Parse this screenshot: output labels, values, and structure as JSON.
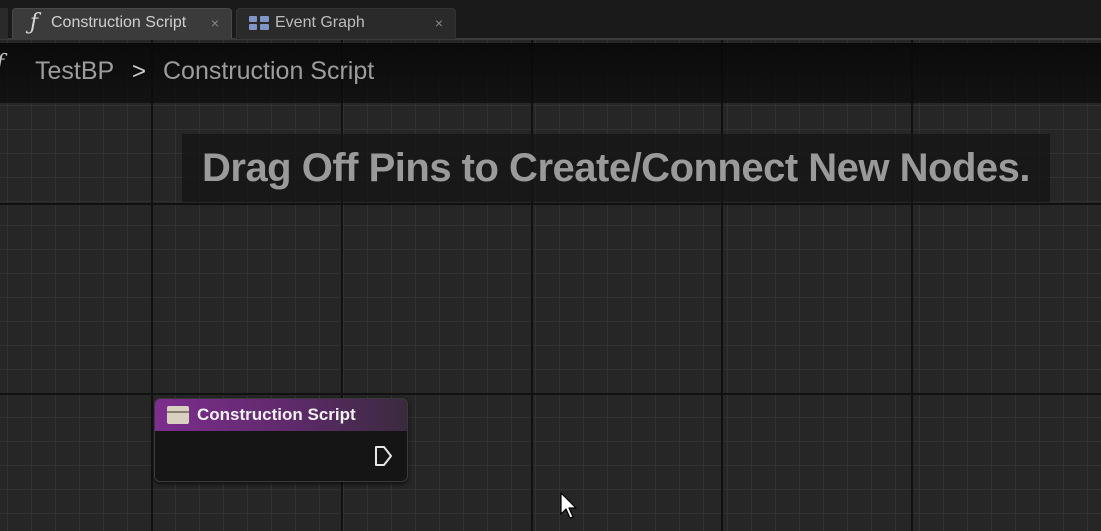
{
  "tabs": [
    {
      "label": "Construction Script",
      "icon": "function-icon",
      "active": true,
      "close": "×"
    },
    {
      "label": "Event Graph",
      "icon": "event-graph-icon",
      "active": false,
      "close": "×"
    }
  ],
  "breadcrumb": {
    "icon_glyph": "f",
    "root": "TestBP",
    "separator": ">",
    "current": "Construction Script"
  },
  "hint": "Drag Off Pins to Create/Connect New Nodes.",
  "node": {
    "title": "Construction Script",
    "header_color": "#7d2d8e"
  },
  "colors": {
    "graph_background": "#262626",
    "grid_major": "#111111",
    "grid_minor": "#323232"
  }
}
